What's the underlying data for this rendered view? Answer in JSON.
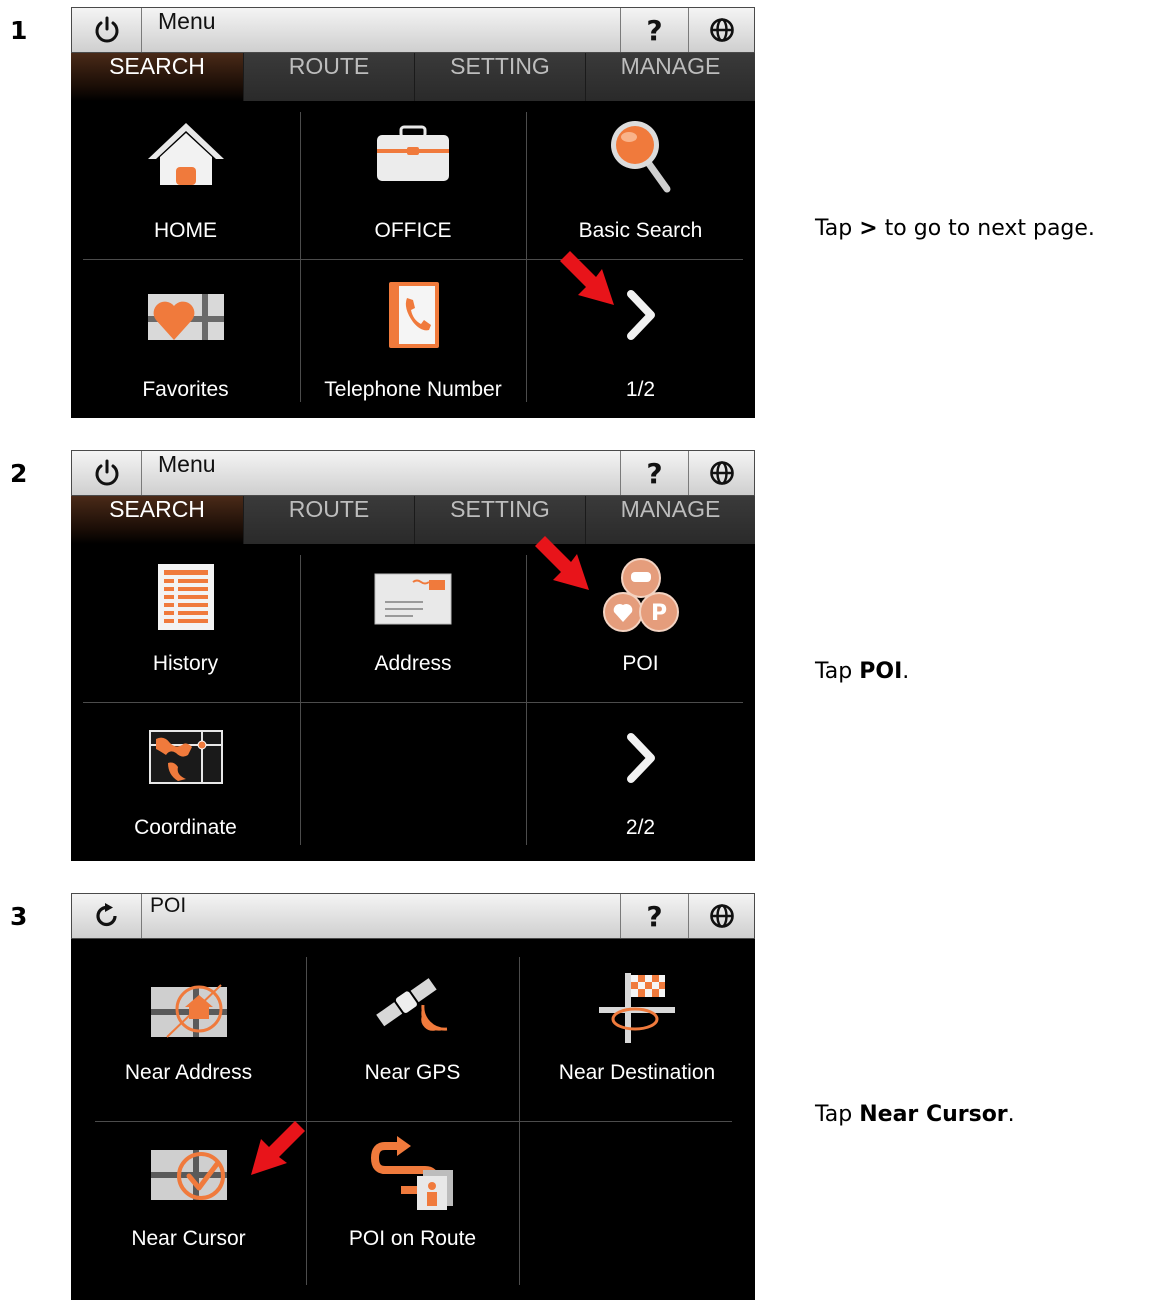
{
  "steps": [
    {
      "number": "1",
      "instruction_prefix": "Tap ",
      "instruction_bold": ">",
      "instruction_suffix": " to go to next page.",
      "screen": {
        "title": "Menu",
        "help": "?",
        "tabs": [
          "SEARCH",
          "ROUTE",
          "SETTING",
          "MANAGE"
        ],
        "active_tab": "SEARCH",
        "items": [
          "HOME",
          "OFFICE",
          "Basic Search",
          "Favorites",
          "Telephone Number",
          "1/2"
        ]
      }
    },
    {
      "number": "2",
      "instruction_prefix": "Tap ",
      "instruction_bold": "POI",
      "instruction_suffix": ".",
      "screen": {
        "title": "Menu",
        "help": "?",
        "tabs": [
          "SEARCH",
          "ROUTE",
          "SETTING",
          "MANAGE"
        ],
        "active_tab": "SEARCH",
        "items": [
          "History",
          "Address",
          "POI",
          "Coordinate",
          "2/2"
        ]
      }
    },
    {
      "number": "3",
      "instruction_prefix": "Tap ",
      "instruction_bold": "Near Cursor",
      "instruction_suffix": ".",
      "screen": {
        "title": "POI",
        "help": "?",
        "items": [
          "Near Address",
          "Near GPS",
          "Near Destination",
          "Near Cursor",
          "POI on Route"
        ]
      }
    }
  ],
  "colors": {
    "accent": "#f07a3c",
    "pointer": "#e8141a",
    "screen_bg": "#000000"
  },
  "icons": [
    "power-icon",
    "back-icon",
    "help-icon",
    "globe-icon",
    "chevron-right-icon"
  ]
}
